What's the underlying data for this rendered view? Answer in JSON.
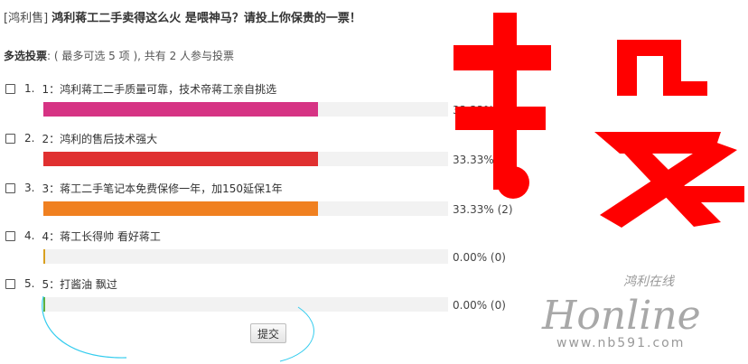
{
  "header": {
    "prefix": "[鸿利售]",
    "title": "鸿利蒋工二手卖得这么火 是喂神马？请投上你保贵的一票！"
  },
  "meta": {
    "label": "多选投票",
    "info": ": ( 最多可选 5 项 ), 共有 2 人参与投票"
  },
  "options": [
    {
      "num": "1.",
      "label": "1：鸿利蒋工二手质量可靠，技术帝蒋工亲自挑选",
      "percent_text": "33.33% (2)",
      "percent": 33.33,
      "color": "#d63384"
    },
    {
      "num": "2.",
      "label": "2：鸿利的售后技术强大",
      "percent_text": "33.33% (2)",
      "percent": 33.33,
      "color": "#e03030"
    },
    {
      "num": "3.",
      "label": "3：蒋工二手笔记本免费保修一年，加150延保1年",
      "percent_text": "33.33% (2)",
      "percent": 33.33,
      "color": "#f08020"
    },
    {
      "num": "4.",
      "label": "4：蒋工长得帅 看好蒋工",
      "percent_text": "0.00% (0)",
      "percent": 0,
      "color": "#d9a020"
    },
    {
      "num": "5.",
      "label": "5：打酱油 飘过",
      "percent_text": "0.00% (0)",
      "percent": 0,
      "color": "#60b040"
    }
  ],
  "submit_label": "提交",
  "decor": {
    "big_char_color": "#ff0000",
    "watermark_script": "鸿利在线",
    "watermark_brand": "Honline",
    "watermark_url": "www.nb591.com"
  }
}
